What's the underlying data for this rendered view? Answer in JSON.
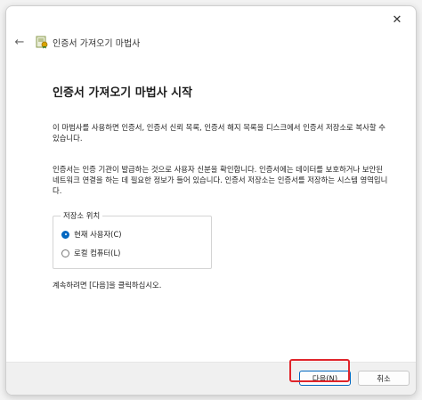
{
  "window": {
    "close_label": "✕",
    "back_label": "←",
    "wizard_name": "인증서 가져오기 마법사"
  },
  "main": {
    "title": "인증서 가져오기 마법사 시작",
    "paragraph1": "이 마법사를 사용하면 인증서, 인증서 신뢰 목록, 인증서 해지 목록을 디스크에서 인증서 저장소로 복사할 수 있습니다.",
    "paragraph2": "인증서는 인증 기관이 발급하는 것으로 사용자 신분을 확인합니다. 인증서에는 데이터를 보호하거나 보안된 네트워크 연결을 하는 데 필요한 정보가 들어 있습니다. 인증서 저장소는 인증서를 저장하는 시스템 영역입니다.",
    "store_location": {
      "legend": "저장소 위치",
      "options": [
        {
          "label": "현재 사용자(C)",
          "checked": true
        },
        {
          "label": "로컬 컴퓨터(L)",
          "checked": false
        }
      ]
    },
    "continue_text": "계속하려면 [다음]을 클릭하십시오."
  },
  "footer": {
    "next_label": "다음(N)",
    "cancel_label": "취소"
  },
  "colors": {
    "accent": "#0067c0",
    "highlight": "#e0242a"
  }
}
